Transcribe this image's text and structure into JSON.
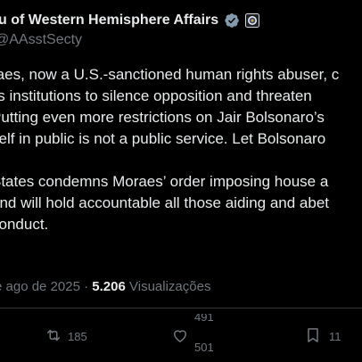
{
  "account": {
    "display_name": "u of Western Hemisphere Affairs",
    "handle": "AAsstSecty"
  },
  "tweet": {
    "lines_para1": [
      "raes, now a U.S.-sanctioned human rights abuser, c",
      "l’s institutions to silence opposition and threaten",
      "  Putting even more restrictions on Jair Bolsonaro’s",
      "self in public is not a public service. Let Bolsonaro"
    ],
    "lines_para2": [
      "States condemns Moraes’ order imposing house a",
      "and will hold accountable all those aiding and abet",
      " conduct."
    ]
  },
  "meta": {
    "date": "e ago de 2025",
    "separator": "·",
    "views_count": "5.206",
    "views_label": "Visualizações"
  },
  "actions": {
    "retweet_count": "185",
    "like_count_old": "491",
    "like_count_new": "501",
    "bookmark_count": "11"
  },
  "colors": {
    "background": "#000000",
    "text": "#e7e9ea",
    "secondary": "#71767b",
    "verified": "#829aab"
  }
}
